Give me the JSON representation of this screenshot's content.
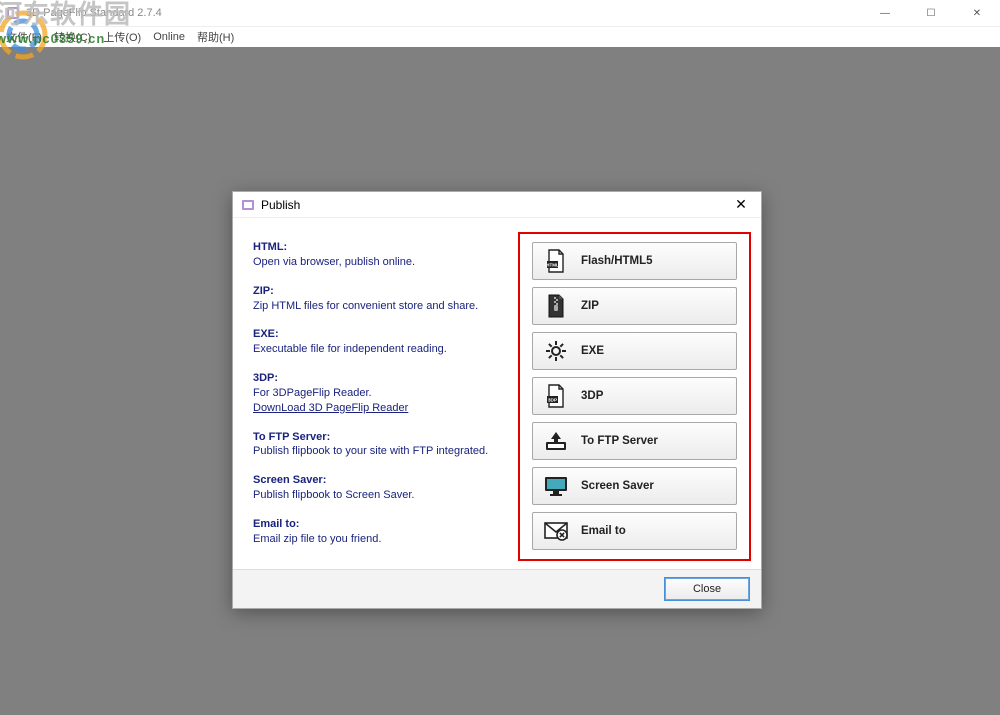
{
  "window": {
    "title": "3D PageFlip Standard 2.7.4",
    "min": "—",
    "max": "☐",
    "close": "✕"
  },
  "menu": {
    "file": "文件(F)",
    "convert": "转换(C)",
    "option": "上传(O)",
    "online": "Online",
    "help": "帮助(H)"
  },
  "watermark": {
    "line1": "河东软件园",
    "line2": "www.pc0359.cn"
  },
  "dialog": {
    "title": "Publish",
    "close_x": "✕",
    "close_btn": "Close",
    "desc": {
      "html_h": "HTML:",
      "html_t": "Open via browser, publish online.",
      "zip_h": "ZIP:",
      "zip_t": "Zip HTML files for convenient store and share.",
      "exe_h": "EXE:",
      "exe_t": "Executable file for independent reading.",
      "tdp_h": "3DP:",
      "tdp_t": "For 3DPageFlip Reader.",
      "tdp_link": "DownLoad 3D PageFlip Reader",
      "ftp_h": "To FTP Server:",
      "ftp_t": "Publish flipbook to your site with FTP integrated.",
      "ss_h": "Screen Saver:",
      "ss_t": "Publish flipbook to Screen Saver.",
      "em_h": "Email to:",
      "em_t": "Email zip file to you friend."
    },
    "buttons": {
      "flash": "Flash/HTML5",
      "zip": "ZIP",
      "exe": "EXE",
      "tdp": "3DP",
      "ftp": "To FTP Server",
      "ss": "Screen Saver",
      "em": "Email to"
    }
  }
}
